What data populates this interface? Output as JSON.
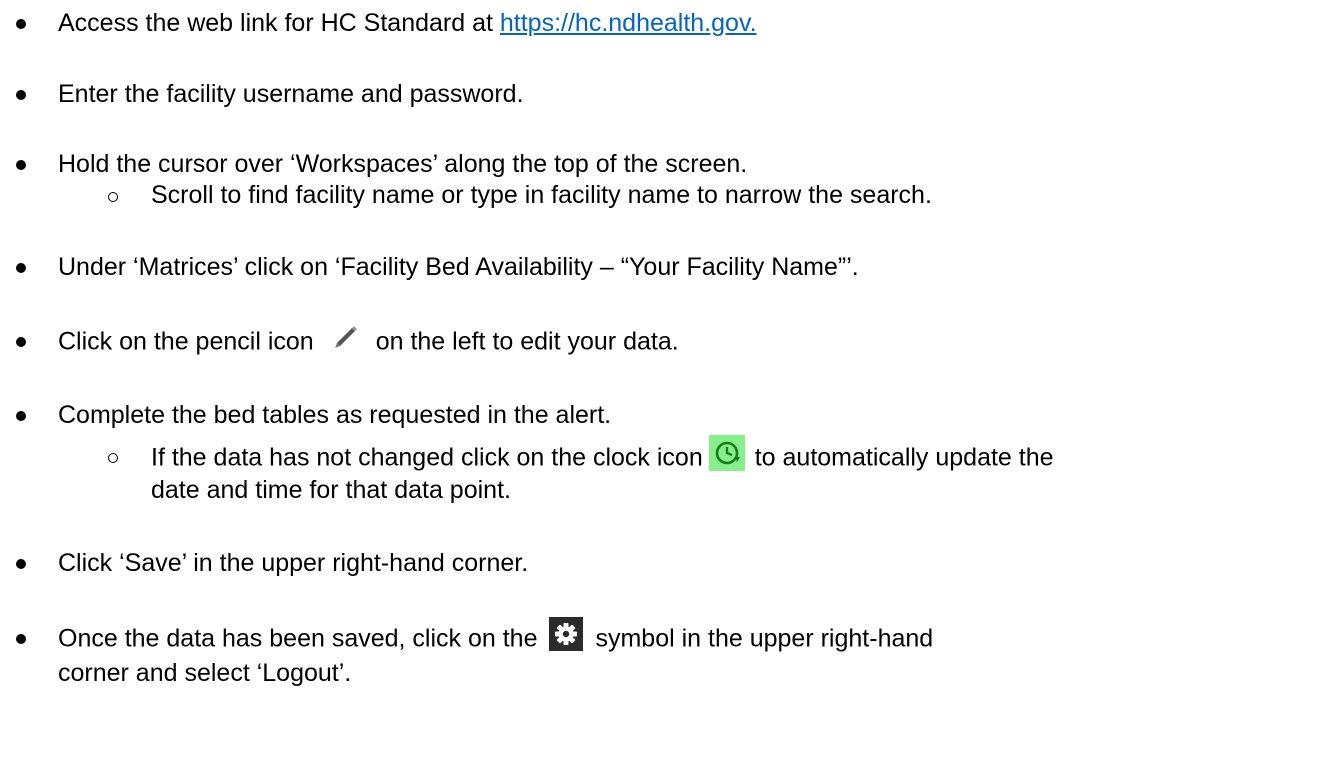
{
  "items": [
    {
      "pre": "Access the web link for HC Standard at ",
      "link": "https://hc.ndhealth.gov."
    },
    {
      "text": "Enter the facility username and password."
    },
    {
      "text": "Hold the cursor over ‘Workspaces’ along the top of the screen."
    },
    {
      "text": "Scroll to find facility name or type in facility name to narrow the search."
    },
    {
      "text": "Under ‘Matrices’ click on ‘Facility Bed Availability – “Your Facility Name”’."
    },
    {
      "pre": "Click on the pencil icon",
      "post": "on the left to edit your data."
    },
    {
      "text": "Complete the bed tables as requested in the alert."
    },
    {
      "pre": "If the data has not changed click on the clock icon",
      "post": "to automatically update the",
      "cont": "date and time for that data point."
    },
    {
      "text": "Click ‘Save’ in the upper right-hand corner."
    },
    {
      "pre": "Once the data has been saved, click on the",
      "post": "symbol in the upper right-hand",
      "cont": "corner and select ‘Logout’."
    }
  ],
  "icons": {
    "pencil": "pencil-icon",
    "clock": "clock-icon",
    "gear": "gear-icon",
    "clock_bg": "#86f08a",
    "gear_bg": "#2b2b2b"
  }
}
